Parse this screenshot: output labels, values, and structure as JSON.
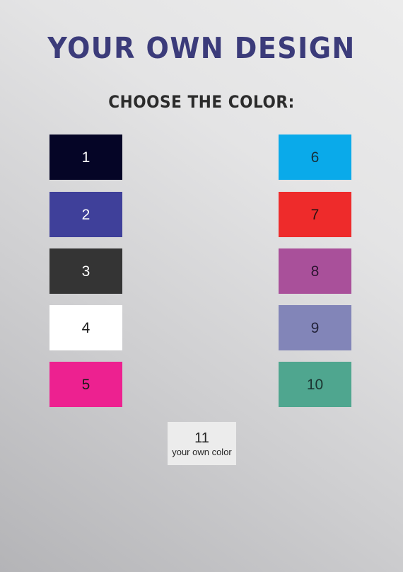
{
  "poster": {
    "title": "YOUR OWN DESIGN",
    "subtitle": "CHOOSE THE COLOR:",
    "title_color": "#3b3b7a",
    "subtitle_color": "#2b2b2b",
    "background_light": "#ececec",
    "background_dark": "#b4b4b7"
  },
  "swatches": [
    {
      "number": "1",
      "color": "#050526",
      "text_color": "#ffffff",
      "column": "left",
      "row": 1
    },
    {
      "number": "2",
      "color": "#3f409a",
      "text_color": "#ffffff",
      "column": "left",
      "row": 2
    },
    {
      "number": "3",
      "color": "#343434",
      "text_color": "#ffffff",
      "column": "left",
      "row": 3
    },
    {
      "number": "4",
      "color": "#ffffff",
      "text_color": "#1a1a1a",
      "column": "left",
      "row": 4
    },
    {
      "number": "5",
      "color": "#ed2190",
      "text_color": "#1a1a1a",
      "column": "left",
      "row": 5
    },
    {
      "number": "6",
      "color": "#0aaaea",
      "text_color": "#17303a",
      "column": "right",
      "row": 1
    },
    {
      "number": "7",
      "color": "#ee2b2b",
      "text_color": "#2a1212",
      "column": "right",
      "row": 2
    },
    {
      "number": "8",
      "color": "#a9509a",
      "text_color": "#2c1430",
      "column": "right",
      "row": 3
    },
    {
      "number": "9",
      "color": "#8285b8",
      "text_color": "#23233a",
      "column": "right",
      "row": 4
    },
    {
      "number": "10",
      "color": "#4fa68f",
      "text_color": "#1b3430",
      "column": "right",
      "row": 5
    }
  ],
  "custom_swatch": {
    "number": "11",
    "caption": "your own color",
    "color": "#ececec",
    "text_color": "#262626"
  }
}
